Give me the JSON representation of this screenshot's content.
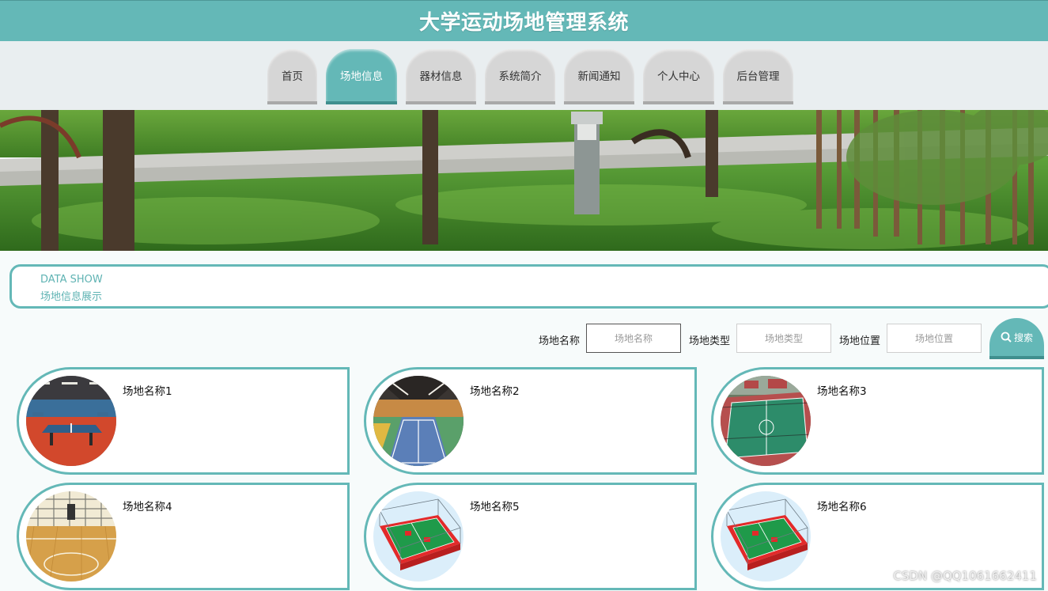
{
  "header": {
    "title": "大学运动场地管理系统"
  },
  "nav": {
    "tabs": [
      {
        "label": "首页"
      },
      {
        "label": "场地信息",
        "active": true
      },
      {
        "label": "器材信息"
      },
      {
        "label": "系统简介"
      },
      {
        "label": "新闻通知"
      },
      {
        "label": "个人中心"
      },
      {
        "label": "后台管理"
      }
    ]
  },
  "section": {
    "en": "DATA SHOW",
    "cn": "场地信息展示"
  },
  "search": {
    "name_label": "场地名称",
    "name_placeholder": "场地名称",
    "type_label": "场地类型",
    "type_placeholder": "场地类型",
    "location_label": "场地位置",
    "location_placeholder": "场地位置",
    "button_label": "搜索"
  },
  "cards": [
    {
      "name": "场地名称1",
      "image": "table-tennis-hall"
    },
    {
      "name": "场地名称2",
      "image": "badminton-hall"
    },
    {
      "name": "场地名称3",
      "image": "outdoor-basketball-court"
    },
    {
      "name": "场地名称4",
      "image": "indoor-basketball-court"
    },
    {
      "name": "场地名称5",
      "image": "fenced-court-render"
    },
    {
      "name": "场地名称6",
      "image": "fenced-court-render"
    }
  ],
  "watermark": "CSDN @QQ1061662411",
  "colors": {
    "accent": "#64b8b7",
    "tab_inactive": "#d6d6d6",
    "nav_bg": "#e9eef0"
  }
}
